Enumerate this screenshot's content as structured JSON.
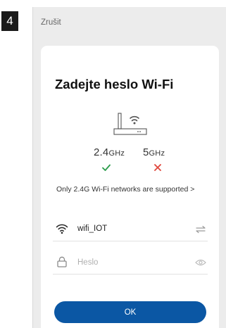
{
  "step": {
    "number": "4"
  },
  "header": {
    "cancel_label": "Zrušit"
  },
  "dialog": {
    "title": "Zadejte heslo Wi-Fi",
    "bands": {
      "band_24": {
        "value": "2.4",
        "unit": "GHz",
        "status": "supported"
      },
      "band_5": {
        "value": "5",
        "unit": "GHz",
        "status": "not-supported"
      }
    },
    "support_note": "Only 2.4G Wi-Fi networks are supported",
    "support_chevron": ">",
    "network": {
      "ssid": "wifi_IOT"
    },
    "password": {
      "placeholder": "Heslo",
      "value": ""
    },
    "ok_label": "OK"
  },
  "icons": {
    "router": "router-wifi-icon",
    "check": "check-icon",
    "cross": "cross-icon",
    "wifi": "wifi-icon",
    "switch": "switch-network-icon",
    "lock": "lock-icon",
    "eye": "eye-icon"
  },
  "colors": {
    "accent": "#0b57a4",
    "ok": "#2e9e4e",
    "error": "#e04a3f",
    "background": "#ececec",
    "card": "#ffffff"
  }
}
